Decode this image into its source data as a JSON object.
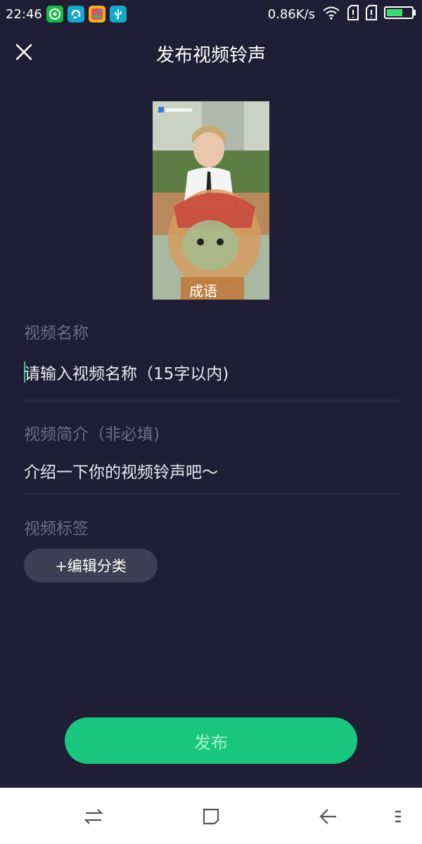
{
  "status_bar": {
    "time": "22:46",
    "network_speed": "0.86K/s",
    "app_icons": [
      "green-circle-app-icon",
      "teal-app-icon",
      "gallery-app-icon",
      "usb-icon"
    ],
    "right_icons": [
      "wifi-icon",
      "sim1-icon",
      "sim2-icon",
      "battery-icon"
    ]
  },
  "header": {
    "title": "发布视频铃声",
    "close_icon": "close-icon"
  },
  "thumbnail": {
    "overlay_caption": "成语"
  },
  "form": {
    "name_label": "视频名称",
    "name_placeholder": "请输入视频名称（15字以内)",
    "intro_label": "视频简介（非必填)",
    "intro_placeholder": "介绍一下你的视频铃声吧～",
    "tags_label": "视频标签",
    "edit_category_label": "+编辑分类"
  },
  "actions": {
    "publish_label": "发布"
  },
  "nav_bar": {
    "icons": [
      "switch-apps-icon",
      "home-icon",
      "back-icon",
      "menu-icon"
    ]
  },
  "colors": {
    "background": "#201e35",
    "accent": "#18c77d",
    "label_gray": "#6d6c80",
    "tag_button": "#3f3e53"
  }
}
